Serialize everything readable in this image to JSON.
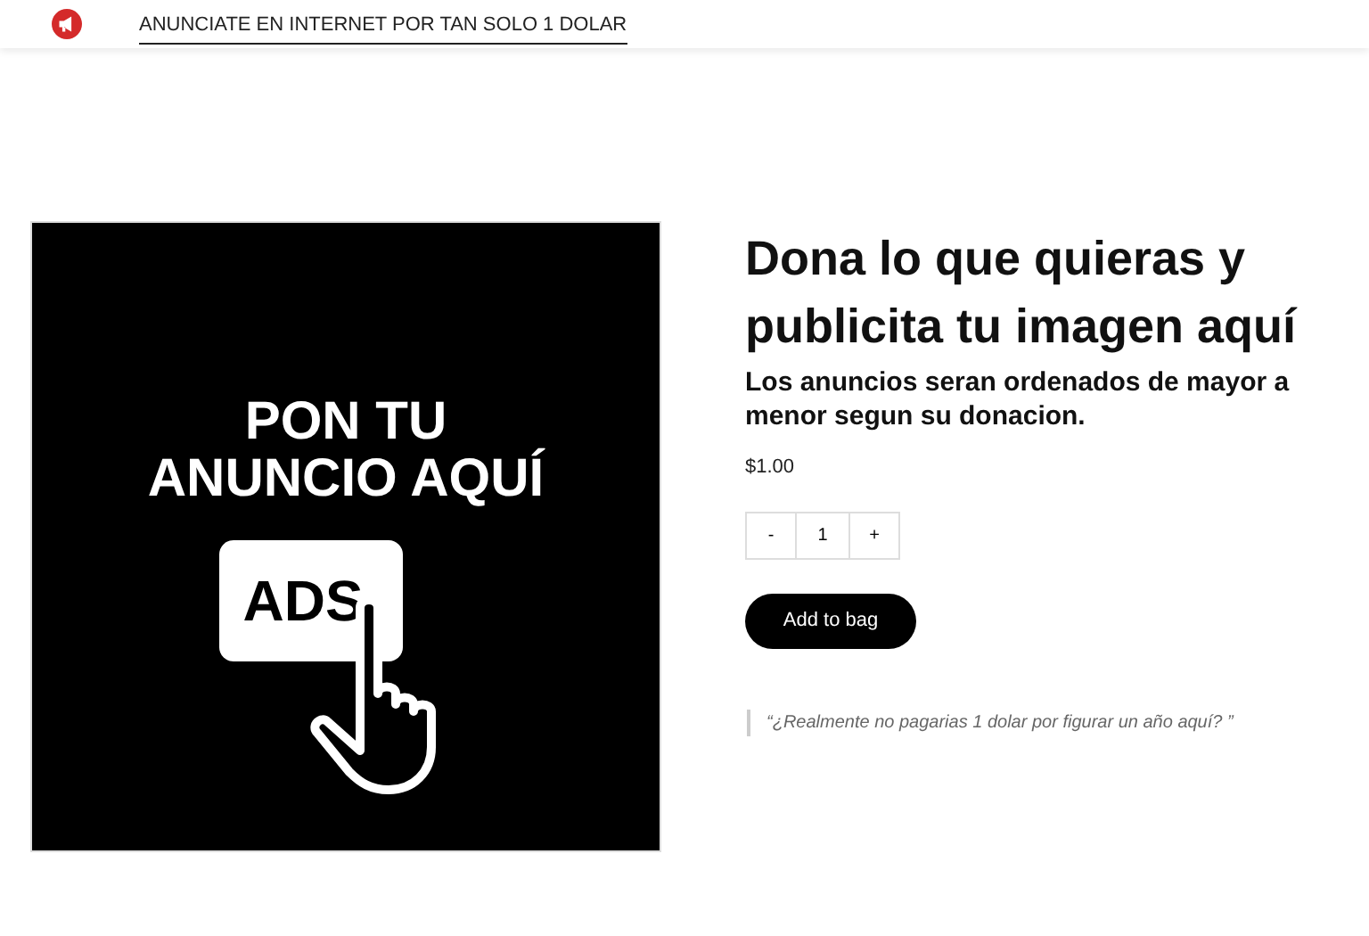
{
  "header": {
    "nav_link": "ANUNCIATE EN INTERNET POR TAN SOLO 1 DOLAR"
  },
  "product": {
    "image": {
      "headline": [
        "PON TU",
        "ANUNCIO AQUÍ"
      ],
      "badge": "ADS"
    },
    "title": "Dona lo que quieras y publicita tu imagen aquí",
    "subtitle": "Los anuncios seran ordenados de mayor a menor segun su donacion.",
    "price": "$1.00",
    "quantity": {
      "minus": "-",
      "value": "1",
      "plus": "+"
    },
    "button": "Add to bag",
    "quote": "“¿Realmente no pagarias 1 dolar por figurar un año aquí? ”"
  }
}
